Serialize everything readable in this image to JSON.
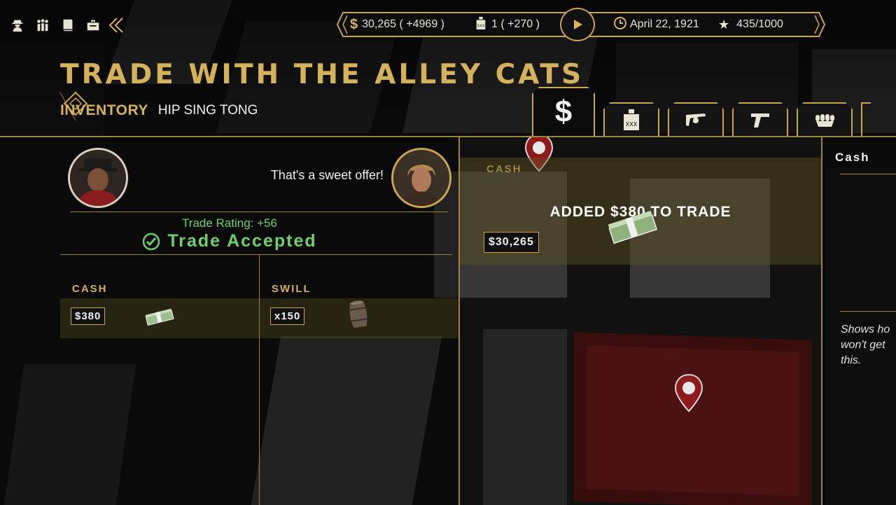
{
  "header": {
    "title": "TRADE WITH THE ALLEY CATS",
    "subtitle_active": "INVENTORY",
    "subtitle_other": "HIP SING TONG"
  },
  "toolbar": {
    "icons": [
      "gangster-icon",
      "crew-icon",
      "ledger-icon",
      "briefcase-icon",
      "collapse-arrows-icon"
    ]
  },
  "stats": {
    "cash": "30,265 ( +4969 )",
    "booze": "1 ( +270 )",
    "date": "April 22, 1921",
    "reputation": "435/1000"
  },
  "tabs": [
    {
      "name": "cash",
      "symbol": "$",
      "active": true
    },
    {
      "name": "booze",
      "active": false
    },
    {
      "name": "tommy-gun",
      "active": false
    },
    {
      "name": "pistol",
      "active": false
    },
    {
      "name": "brass-knuckles",
      "active": false
    }
  ],
  "trade": {
    "speech": "That's a sweet offer!",
    "rating": "Trade Rating: +56",
    "status": "Trade Accepted",
    "my_offer": {
      "label": "CASH",
      "value": "$380"
    },
    "their_offer": {
      "label": "SWILL",
      "value": "x150"
    }
  },
  "center": {
    "label": "CASH",
    "message": "ADDED $380 TO TRADE",
    "balance": "$30,265"
  },
  "right_panel": {
    "label": "Cash",
    "desc_lines": [
      "Shows ho",
      "won't get",
      "this."
    ]
  },
  "colors": {
    "gold": "#d4b25c",
    "accept_green": "#6fd06b",
    "map_red": "#7a1d1d"
  }
}
